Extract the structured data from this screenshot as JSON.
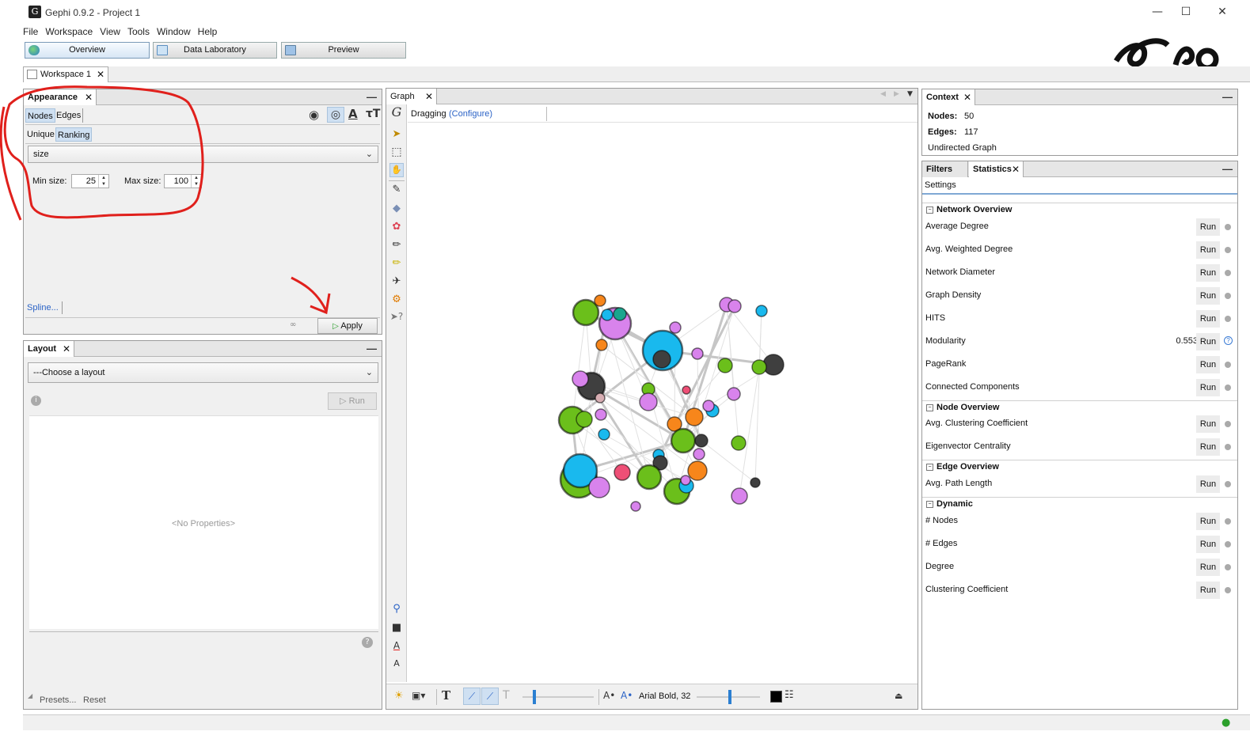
{
  "window": {
    "title": "Gephi 0.9.2 - Project 1",
    "app_icon": "gephi-logo-icon",
    "controls": [
      "minimize-icon",
      "maximize-icon",
      "close-icon"
    ]
  },
  "menu": [
    "File",
    "Workspace",
    "View",
    "Tools",
    "Window",
    "Help"
  ],
  "perspectives": {
    "overview": "Overview",
    "data_lab": "Data Laboratory",
    "preview": "Preview"
  },
  "workspace_tab": "Workspace 1",
  "appearance": {
    "tab": "Appearance",
    "nodes": "Nodes",
    "edges": "Edges",
    "unique": "Unique",
    "ranking": "Ranking",
    "attribute": "size",
    "min_label": "Min size:",
    "min_value": "25",
    "max_label": "Max size:",
    "max_value": "100",
    "spline": "Spline...",
    "apply": "Apply",
    "annotation_color": "#e0201c"
  },
  "layout": {
    "tab": "Layout",
    "choose": "---Choose a layout",
    "run": "Run",
    "no_props": "<No Properties>",
    "presets": "Presets...",
    "reset": "Reset"
  },
  "graph": {
    "tab": "Graph",
    "mode": "Dragging",
    "configure": "(Configure)",
    "font_label": "Arial Bold, 32",
    "colors": {
      "green": "#6bbf1b",
      "cyan": "#19b9ee",
      "violet": "#d883ec",
      "orange": "#f7861b",
      "dark": "#3f3f3f",
      "teal": "#1aa68e",
      "rose": "#ee4f76",
      "pink": "#d7aeb3"
    }
  },
  "context": {
    "tab": "Context",
    "nodes_label": "Nodes:",
    "nodes_value": "50",
    "edges_label": "Edges:",
    "edges_value": "117",
    "graph_type": "Undirected Graph"
  },
  "stats": {
    "filters_tab": "Filters",
    "statistics_tab": "Statistics",
    "settings": "Settings",
    "run": "Run",
    "sections": {
      "network": "Network Overview",
      "node": "Node Overview",
      "edge": "Edge Overview",
      "dynamic": "Dynamic"
    },
    "rows": {
      "avg_degree": "Average Degree",
      "avg_weighted": "Avg. Weighted Degree",
      "diameter": "Network Diameter",
      "density": "Graph Density",
      "hits": "HITS",
      "modularity": "Modularity",
      "modularity_value": "0.553",
      "pagerank": "PageRank",
      "connected": "Connected Components",
      "clustering": "Avg. Clustering Coefficient",
      "eigen": "Eigenvector Centrality",
      "path_length": "Avg. Path Length",
      "dyn_nodes": "# Nodes",
      "dyn_edges": "# Edges",
      "degree": "Degree",
      "clust_coef": "Clustering Coefficient"
    }
  }
}
